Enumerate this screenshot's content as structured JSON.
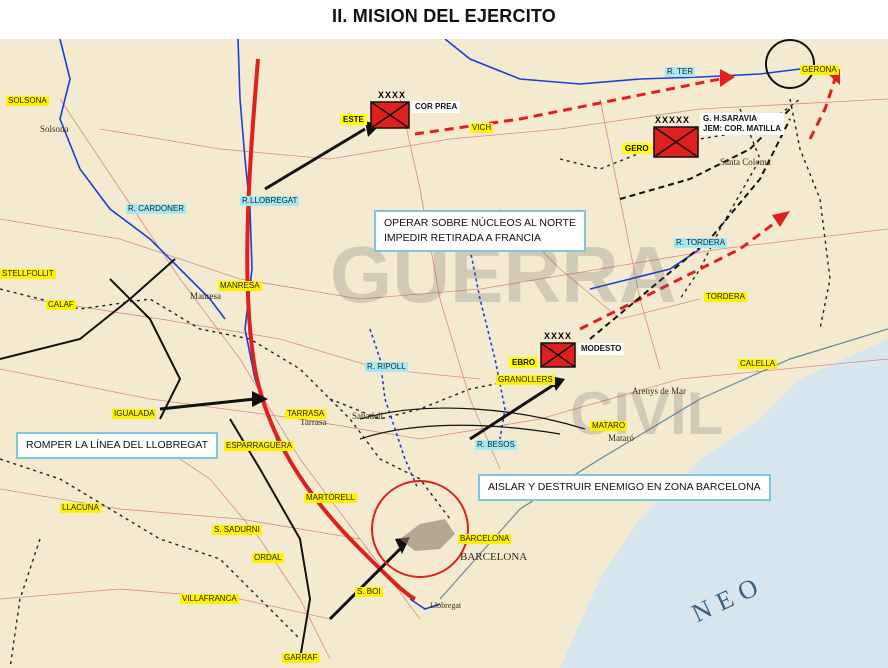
{
  "title": "II. MISION DEL EJERCITO",
  "callouts": {
    "northern": [
      "OPERAR SOBRE NÚCLEOS AL NORTE",
      "IMPEDIR RETIRADA A FRANCIA"
    ],
    "llobregat": "ROMPER LA LÍNEA DEL LLOBREGAT",
    "barcelona": "AISLAR Y DESTRUIR ENEMIGO EN ZONA BARCELONA"
  },
  "units": {
    "este": {
      "tag": "ESTE",
      "echelon": "XXXX",
      "commander": "COR PREA"
    },
    "gero": {
      "tag": "GERO",
      "echelon": "XXXXX",
      "commander_lines": [
        "G. H.SARAVIA",
        "JEM: COR. MATILLA"
      ]
    },
    "ebro": {
      "tag": "EBRO",
      "echelon": "XXXX",
      "commander": "MODESTO"
    }
  },
  "rivers": {
    "ter": "R. TER",
    "cardoner": "R. CARDONER",
    "llobregat": "R.LLOBREGAT",
    "ripoll": "R. RIPOLL",
    "tordera": "R. TORDERA",
    "besos": "R. BESOS"
  },
  "towns_yellow": [
    "SOLSONA",
    "STELLFOLLIT",
    "CALAF",
    "MANRESA",
    "IGUALADA",
    "ESPARRAGUERA",
    "TARRASA",
    "MARTORELL",
    "S. SADURNI",
    "ORDAL",
    "VILLAFRANCA",
    "S. BOI",
    "GARRAF",
    "LLACUNA",
    "BARCELONA",
    "GRANOLLERS",
    "MATARO",
    "CALELLA",
    "TORDERA",
    "GERONA",
    "VICH"
  ],
  "map_places": [
    "Solsona",
    "Manresa",
    "Tarrasa",
    "Sabadell",
    "BARCELONA",
    "Mataró",
    "Arenys de Mar",
    "Santa Coloma",
    "Llobregat"
  ],
  "sea_text": "NEO",
  "watermark": [
    "GUERRA",
    "CIVIL"
  ],
  "colors": {
    "front_line": "#e0201f",
    "advance_red": "#e0201f",
    "arrows": "#111111",
    "rivers": "#1a3fd6",
    "unit_box": "#e0201f",
    "callout_border": "#7ec6e0",
    "tag": "#ffff00"
  }
}
